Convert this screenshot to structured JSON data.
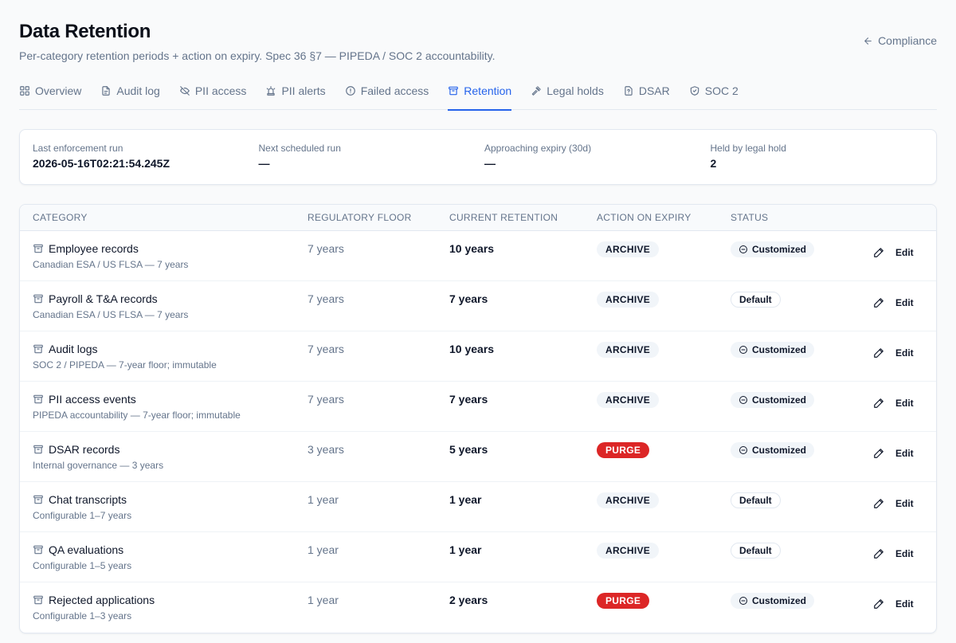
{
  "header": {
    "title": "Data Retention",
    "subtitle": "Per-category retention periods + action on expiry. Spec 36 §7 — PIPEDA / SOC 2 accountability.",
    "back_label": "Compliance"
  },
  "tabs": [
    {
      "label": "Overview",
      "icon": "grid-icon"
    },
    {
      "label": "Audit log",
      "icon": "file-icon"
    },
    {
      "label": "PII access",
      "icon": "eye-off-icon"
    },
    {
      "label": "PII alerts",
      "icon": "siren-icon"
    },
    {
      "label": "Failed access",
      "icon": "alert-circle-icon"
    },
    {
      "label": "Retention",
      "icon": "archive-icon",
      "active": true
    },
    {
      "label": "Legal holds",
      "icon": "gavel-icon"
    },
    {
      "label": "DSAR",
      "icon": "file-question-icon"
    },
    {
      "label": "SOC 2",
      "icon": "shield-icon"
    }
  ],
  "stats": [
    {
      "label": "Last enforcement run",
      "value": "2026-05-16T02:21:54.245Z"
    },
    {
      "label": "Next scheduled run",
      "value": "—"
    },
    {
      "label": "Approaching expiry (30d)",
      "value": "—"
    },
    {
      "label": "Held by legal hold",
      "value": "2"
    }
  ],
  "table": {
    "columns": [
      "Category",
      "Regulatory floor",
      "Current retention",
      "Action on expiry",
      "Status"
    ],
    "edit_label": "Edit",
    "rows": [
      {
        "name": "Employee records",
        "sub": "Canadian ESA / US FLSA — 7 years",
        "floor": "7 years",
        "current": "10 years",
        "action": "ARCHIVE",
        "status": "Customized"
      },
      {
        "name": "Payroll & T&A records",
        "sub": "Canadian ESA / US FLSA — 7 years",
        "floor": "7 years",
        "current": "7 years",
        "action": "ARCHIVE",
        "status": "Default"
      },
      {
        "name": "Audit logs",
        "sub": "SOC 2 / PIPEDA — 7-year floor; immutable",
        "floor": "7 years",
        "current": "10 years",
        "action": "ARCHIVE",
        "status": "Customized"
      },
      {
        "name": "PII access events",
        "sub": "PIPEDA accountability — 7-year floor; immutable",
        "floor": "7 years",
        "current": "7 years",
        "action": "ARCHIVE",
        "status": "Customized"
      },
      {
        "name": "DSAR records",
        "sub": "Internal governance — 3 years",
        "floor": "3 years",
        "current": "5 years",
        "action": "PURGE",
        "status": "Customized"
      },
      {
        "name": "Chat transcripts",
        "sub": "Configurable 1–7 years",
        "floor": "1 year",
        "current": "1 year",
        "action": "ARCHIVE",
        "status": "Default"
      },
      {
        "name": "QA evaluations",
        "sub": "Configurable 1–5 years",
        "floor": "1 year",
        "current": "1 year",
        "action": "ARCHIVE",
        "status": "Default"
      },
      {
        "name": "Rejected applications",
        "sub": "Configurable 1–3 years",
        "floor": "1 year",
        "current": "2 years",
        "action": "PURGE",
        "status": "Customized"
      }
    ]
  },
  "colors": {
    "accent": "#2563eb",
    "purge": "#dc2626",
    "muted": "#64748b"
  }
}
